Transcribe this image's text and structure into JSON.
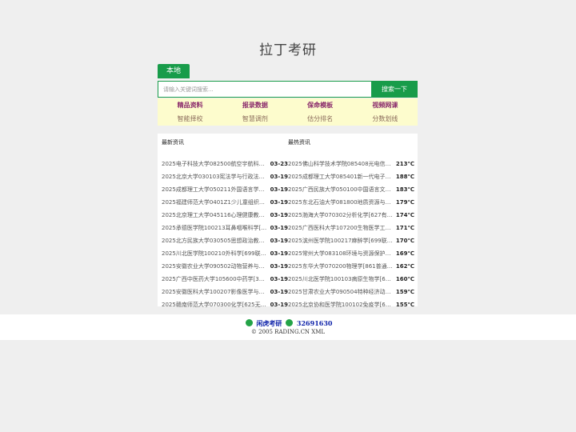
{
  "site": {
    "title": "拉丁考研"
  },
  "tabs": {
    "local_label": "本地"
  },
  "search": {
    "placeholder": "请输入关键词搜索...",
    "button_label": "搜索一下"
  },
  "quick_links": {
    "row1": [
      "精品资料",
      "报录数据",
      "保命模板",
      "视频网课"
    ],
    "row2": [
      "智能择校",
      "智慧调剂",
      "估分排名",
      "分数划线"
    ]
  },
  "news": {
    "latest_header": "最新资讯",
    "hot_header": "最热资讯",
    "latest": [
      {
        "title": "2025电子科技大学082500航空宇航科学...",
        "date": "03-23"
      },
      {
        "title": "2025北京大学030103宪法学与行政法学[6...",
        "date": "03-19"
      },
      {
        "title": "2025成都理工大学050211外国语言学及应...",
        "date": "03-19"
      },
      {
        "title": "2025福建师范大学0401Z1少儿童组织与...",
        "date": "03-19"
      },
      {
        "title": "2025北京理工大学045116心理健康教育[3...",
        "date": "03-19"
      },
      {
        "title": "2025承德医学院100213耳鼻咽喉科学[69...",
        "date": "03-19"
      },
      {
        "title": "2025北方民族大学030505思想政治教育[8...",
        "date": "03-19"
      },
      {
        "title": "2025川北医学院100210外科学[699联考...",
        "date": "03-19"
      },
      {
        "title": "2025安徽农业大学090502动物营养与饲...",
        "date": "03-19"
      },
      {
        "title": "2025广西中医药大学105600中药学[350...",
        "date": "03-19"
      },
      {
        "title": "2025安徽医科大学100207影像医学与核...",
        "date": "03-19"
      },
      {
        "title": "2025赣南师范大学070300化学[625无机...",
        "date": "03-19"
      }
    ],
    "hot": [
      {
        "title": "2025佛山科学技术学院085408光电信息...",
        "heat": "213℃"
      },
      {
        "title": "2025成都理工大学085401新一代电子信...",
        "heat": "188℃"
      },
      {
        "title": "2025广西民族大学050100中国语言文学[...",
        "heat": "183℃"
      },
      {
        "title": "2025东北石油大学081800地质资源与地...",
        "heat": "179℃"
      },
      {
        "title": "2025渤海大学070302分析化学[627有机...",
        "heat": "174℃"
      },
      {
        "title": "2025广西医科大学107200生物医学工程[...",
        "heat": "171℃"
      },
      {
        "title": "2025滨州医学院100217麻醉学[699联考...",
        "heat": "170℃"
      },
      {
        "title": "2025常州大学083108环境与资源保护法...",
        "heat": "169℃"
      },
      {
        "title": "2025东华大学070200物理学[861普通物...",
        "heat": "162℃"
      },
      {
        "title": "2025川北医学院100103病原生物学[699...",
        "heat": "160℃"
      },
      {
        "title": "2025甘肃农业大学090504特种经济动物...",
        "heat": "159℃"
      },
      {
        "title": "2025北京协和医学院100102免疫学[654...",
        "heat": "155℃"
      }
    ]
  },
  "footer": {
    "brand": "闲虎考研",
    "qq": "32691630",
    "copyright": "©  2005  RADING.CN  XML"
  },
  "colors": {
    "accent": "#189c4a",
    "quick_bg": "#fdfccd",
    "footer_link": "#0a1fa8"
  }
}
